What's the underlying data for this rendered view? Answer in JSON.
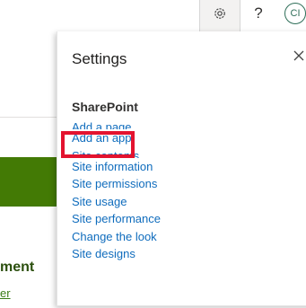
{
  "header": {
    "avatar_initials": "CI",
    "icons": [
      "megaphone-icon",
      "gear-icon",
      "help-icon"
    ],
    "help_glyph": "?"
  },
  "background": {
    "heading_partial": "ment",
    "link_partial": "er",
    "hero_color": "#437a05"
  },
  "settings_panel": {
    "title": "Settings",
    "close_glyph": "✕",
    "section_title": "SharePoint",
    "items": [
      {
        "label": "Add a page"
      },
      {
        "label": "Add an app",
        "highlighted": true
      },
      {
        "label": "Site contents"
      },
      {
        "label": "Site information"
      },
      {
        "label": "Site permissions"
      },
      {
        "label": "Site usage"
      },
      {
        "label": "Site performance"
      },
      {
        "label": "Change the look"
      },
      {
        "label": "Site designs"
      }
    ]
  },
  "colors": {
    "link": "#0f6cbd",
    "highlight": "#e3132f",
    "avatar": "#2e6e58"
  }
}
